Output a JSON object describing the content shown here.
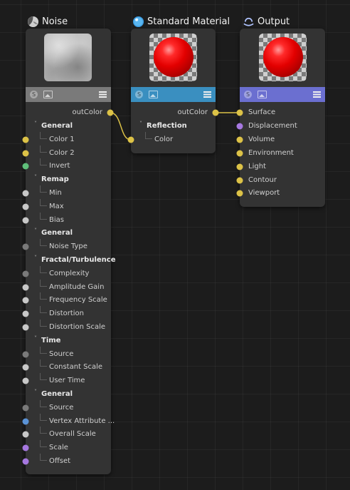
{
  "nodes": {
    "noise": {
      "title": "Noise",
      "icon": "noise-icon",
      "toolbar_color": "#7a7a7a",
      "output": "outColor",
      "rows": [
        {
          "label": "General",
          "group": true
        },
        {
          "label": "Color 1",
          "port": "yellow"
        },
        {
          "label": "Color 2",
          "port": "yellow"
        },
        {
          "label": "Invert",
          "port": "green"
        },
        {
          "label": "Remap",
          "group": true
        },
        {
          "label": "Min",
          "port": "white"
        },
        {
          "label": "Max",
          "port": "white"
        },
        {
          "label": "Bias",
          "port": "white"
        },
        {
          "label": "General",
          "group": true
        },
        {
          "label": "Noise Type",
          "port": "gray"
        },
        {
          "label": "Fractal/Turbulence",
          "group": true
        },
        {
          "label": "Complexity",
          "port": "gray"
        },
        {
          "label": "Amplitude Gain",
          "port": "white"
        },
        {
          "label": "Frequency Scale",
          "port": "white"
        },
        {
          "label": "Distortion",
          "port": "white"
        },
        {
          "label": "Distortion Scale",
          "port": "white"
        },
        {
          "label": "Time",
          "group": true
        },
        {
          "label": "Source",
          "port": "gray"
        },
        {
          "label": "Constant Scale",
          "port": "white"
        },
        {
          "label": "User Time",
          "port": "white"
        },
        {
          "label": "General",
          "group": true
        },
        {
          "label": "Source",
          "port": "gray"
        },
        {
          "label": "Vertex Attribute ...",
          "port": "blue"
        },
        {
          "label": "Overall Scale",
          "port": "white"
        },
        {
          "label": "Scale",
          "port": "purple"
        },
        {
          "label": "Offset",
          "port": "purple"
        }
      ]
    },
    "material": {
      "title": "Standard Material",
      "icon": "material-sphere-icon",
      "toolbar_color": "#3a8fc0",
      "output": "outColor",
      "rows": [
        {
          "label": "Reflection",
          "group": true
        },
        {
          "label": "Color",
          "port": "yellow"
        }
      ]
    },
    "output": {
      "title": "Output",
      "icon": "output-icon",
      "toolbar_color": "#6b6fd0",
      "rows": [
        {
          "label": "Surface",
          "port": "yellow"
        },
        {
          "label": "Displacement",
          "port": "purple"
        },
        {
          "label": "Volume",
          "port": "yellow"
        },
        {
          "label": "Environment",
          "port": "yellow"
        },
        {
          "label": "Light",
          "port": "yellow"
        },
        {
          "label": "Contour",
          "port": "yellow"
        },
        {
          "label": "Viewport",
          "port": "yellow"
        }
      ]
    }
  },
  "colors": {
    "wire": "#dcc247",
    "node_bg": "#333333",
    "canvas_bg": "#1c1c1c"
  }
}
